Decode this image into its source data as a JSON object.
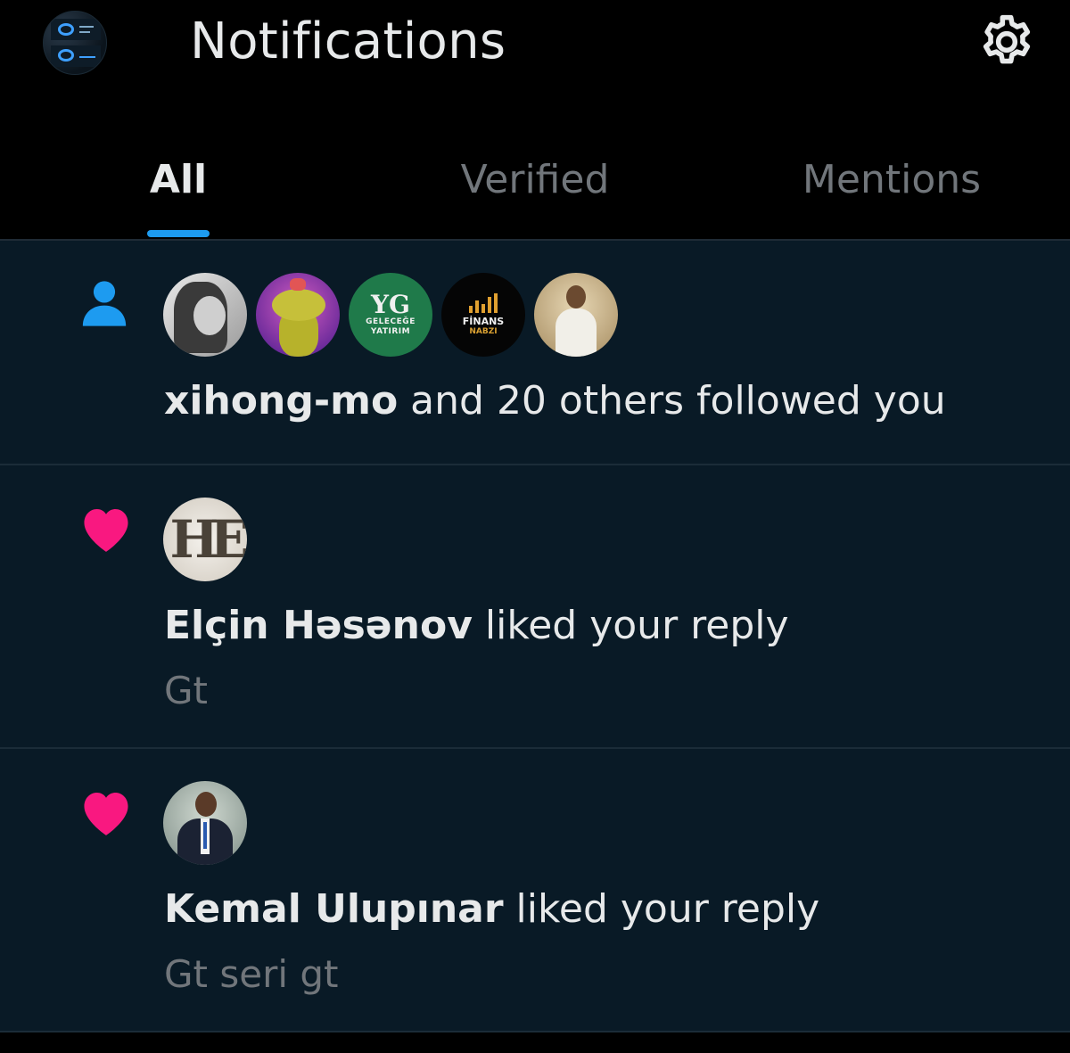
{
  "header": {
    "title": "Notifications",
    "profile_icon": "profile-avatar",
    "settings_icon": "gear-icon"
  },
  "tabs": [
    {
      "label": "All",
      "active": true
    },
    {
      "label": "Verified",
      "active": false
    },
    {
      "label": "Mentions",
      "active": false
    }
  ],
  "notifications": [
    {
      "type": "follow",
      "icon": "person-icon",
      "avatars": [
        {
          "name": "follower-avatar-1"
        },
        {
          "name": "follower-avatar-2"
        },
        {
          "name": "follower-avatar-3",
          "text_lines": [
            "GELECEĞE",
            "YATIRIM"
          ]
        },
        {
          "name": "follower-avatar-4",
          "text_lines": [
            "FİNANS",
            "NABZI"
          ]
        },
        {
          "name": "follower-avatar-5"
        }
      ],
      "actor": "xihong-mo",
      "text": " and 20 others followed you"
    },
    {
      "type": "like",
      "icon": "heart-icon",
      "actor": "Elçin Həsənov",
      "text": " liked your reply",
      "snippet": "Gt"
    },
    {
      "type": "like",
      "icon": "heart-icon",
      "actor": "Kemal Ulupınar",
      "text": " liked your reply",
      "snippet": "Gt seri gt"
    }
  ],
  "colors": {
    "accent": "#1d9bf0",
    "like": "#f91880",
    "follow": "#1d9bf0",
    "feed_bg": "#091a26",
    "muted_text": "#71767b"
  }
}
